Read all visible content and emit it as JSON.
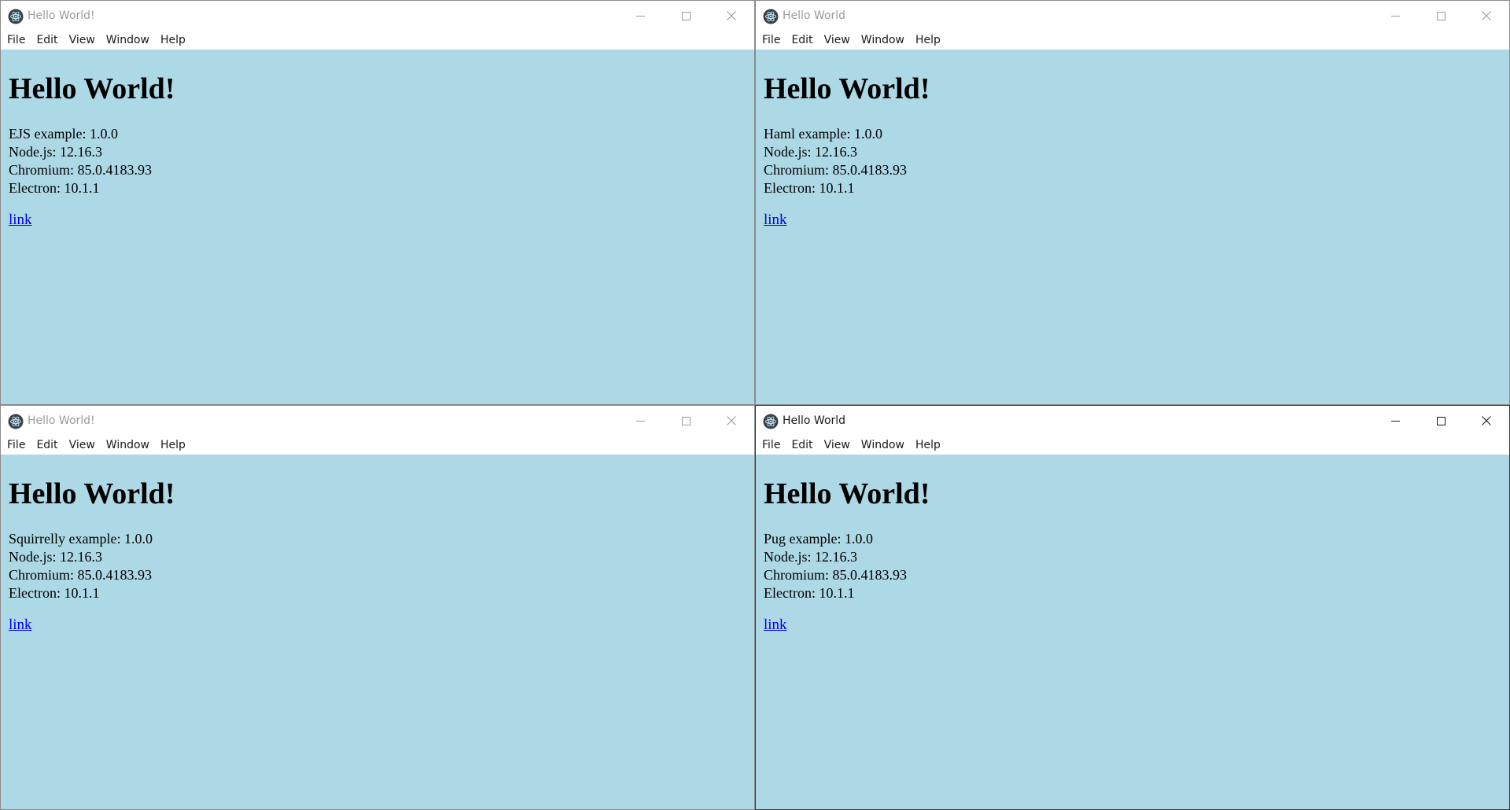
{
  "colors": {
    "content_background": "#add8e6",
    "link": "#0000ee",
    "inactive_title": "#9b9b9b",
    "active_title": "#1a1a1a",
    "taskbar_accent": "#0078d7"
  },
  "windows": [
    {
      "title": "Hello World!",
      "active": false,
      "menu": [
        "File",
        "Edit",
        "View",
        "Window",
        "Help"
      ],
      "heading": "Hello World!",
      "info": [
        "EJS example: 1.0.0",
        "Node.js: 12.16.3",
        "Chromium: 85.0.4183.93",
        "Electron: 10.1.1"
      ],
      "link": "link"
    },
    {
      "title": "Hello World",
      "active": false,
      "menu": [
        "File",
        "Edit",
        "View",
        "Window",
        "Help"
      ],
      "heading": "Hello World!",
      "info": [
        "Haml example: 1.0.0",
        "Node.js: 12.16.3",
        "Chromium: 85.0.4183.93",
        "Electron: 10.1.1"
      ],
      "link": "link"
    },
    {
      "title": "Hello World!",
      "active": false,
      "menu": [
        "File",
        "Edit",
        "View",
        "Window",
        "Help"
      ],
      "heading": "Hello World!",
      "info": [
        "Squirrelly example: 1.0.0",
        "Node.js: 12.16.3",
        "Chromium: 85.0.4183.93",
        "Electron: 10.1.1"
      ],
      "link": "link"
    },
    {
      "title": "Hello World",
      "active": true,
      "menu": [
        "File",
        "Edit",
        "View",
        "Window",
        "Help"
      ],
      "heading": "Hello World!",
      "info": [
        "Pug example: 1.0.0",
        "Node.js: 12.16.3",
        "Chromium: 85.0.4183.93",
        "Electron: 10.1.1"
      ],
      "link": "link"
    }
  ],
  "icons": {
    "app": "electron-app-icon",
    "minimize": "minimize-icon",
    "maximize": "maximize-icon",
    "close": "close-icon"
  }
}
